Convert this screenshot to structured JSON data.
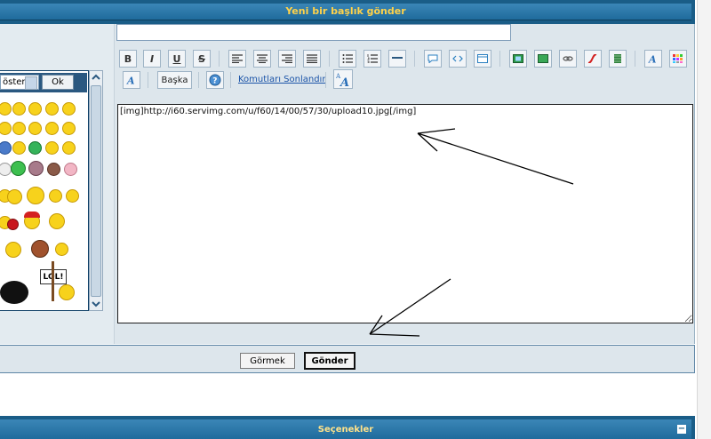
{
  "header": {
    "title": "Yeni bir başlık gönder"
  },
  "subject": {
    "value": ""
  },
  "toolbar": {
    "bold_label": "B",
    "italic_label": "I",
    "underline_label": "U",
    "strike_label": "S",
    "more_label": "Başka",
    "close_tags_label": "Komutları Sonlandır"
  },
  "emoji_panel": {
    "select_value": "öster",
    "ok_label": "Ok",
    "lol_sign": "LOL!"
  },
  "editor": {
    "content": "[img]http://i60.servimg.com/u/f60/14/00/57/30/upload10.jpg[/img]"
  },
  "actions": {
    "preview_label": "Görmek",
    "send_label": "Gönder"
  },
  "options": {
    "title": "Seçenekler",
    "collapse_symbol": "−"
  },
  "colors": {
    "header_bg": "#1a5d87",
    "header_text": "#ffd24a",
    "panel_bg": "#dde6ec",
    "link": "#1b54a8"
  }
}
